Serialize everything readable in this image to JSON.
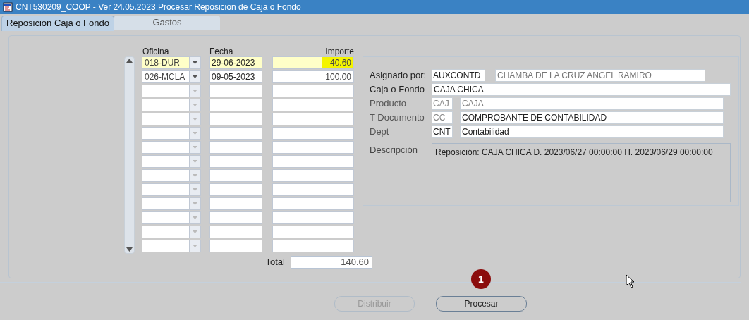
{
  "window": {
    "title": "CNT530209_COOP - Ver 24.05.2023 Procesar Reposición de Caja o Fondo"
  },
  "tabs": [
    {
      "label": "Reposicion Caja o Fondo",
      "selected": true
    },
    {
      "label": "Gastos",
      "selected": false
    }
  ],
  "table": {
    "columns": [
      "Oficina",
      "Fecha",
      "Importe"
    ],
    "rows": [
      {
        "selected": true,
        "oficina": "018-DUR",
        "fecha": "29-06-2023",
        "importe": "40.60"
      },
      {
        "selected": false,
        "oficina": "026-MCLA",
        "fecha": "09-05-2023",
        "importe": "100.00"
      },
      {
        "selected": false
      },
      {
        "selected": false
      },
      {
        "selected": false
      },
      {
        "selected": false
      },
      {
        "selected": false
      },
      {
        "selected": false
      },
      {
        "selected": false
      },
      {
        "selected": false
      },
      {
        "selected": false
      },
      {
        "selected": false
      },
      {
        "selected": false
      },
      {
        "selected": false
      }
    ],
    "total_label": "Total",
    "total": "140.60"
  },
  "details": [
    {
      "label": "Asignado por:",
      "code": "AUXCONTD",
      "value": "CHAMBA DE LA CRUZ ANGEL RAMIRO",
      "disabled": true
    },
    {
      "label": "Caja o Fondo",
      "value": "CAJA CHICA",
      "disabled": false
    },
    {
      "label": "Producto",
      "code": "CAJ",
      "value": "CAJA",
      "disabled": true
    },
    {
      "label": "T Documento",
      "code": "CC",
      "value": "COMPROBANTE DE CONTABILIDAD",
      "disabled": false
    },
    {
      "label": "Dept",
      "code": "CNT",
      "value": "Contabilidad",
      "disabled": false
    }
  ],
  "description": {
    "label": "Descripción",
    "value": "Reposición: CAJA CHICA D. 2023/06/27 00:00:00 H. 2023/06/29 00:00:00"
  },
  "callout": "1",
  "buttons": [
    {
      "label": "Distribuir",
      "disabled": true
    },
    {
      "label": "Procesar",
      "disabled": false
    }
  ]
}
